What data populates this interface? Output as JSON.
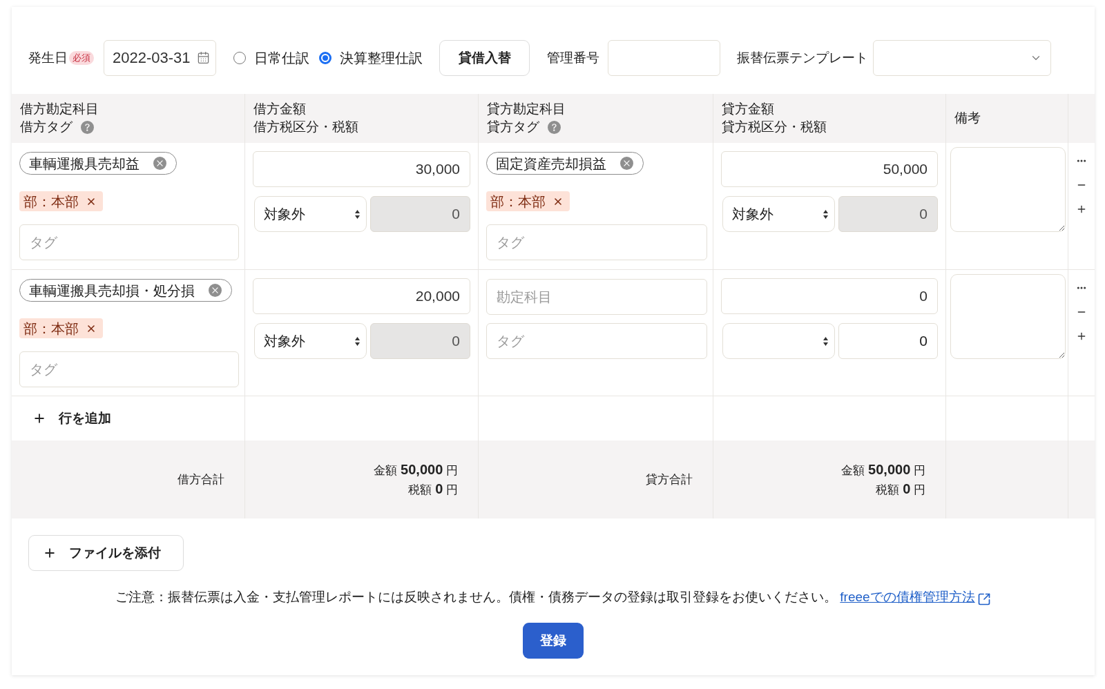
{
  "header": {
    "date_label": "発生日",
    "required_badge": "必須",
    "date_value": "2022-03-31",
    "entry_types": [
      {
        "label": "日常仕訳",
        "selected": false
      },
      {
        "label": "決算整理仕訳",
        "selected": true
      }
    ],
    "swap_button": "貸借入替",
    "control_number_label": "管理番号",
    "template_label": "振替伝票テンプレート"
  },
  "table": {
    "columns": [
      {
        "lines": [
          "借方勘定科目",
          "借方タグ"
        ],
        "help": true
      },
      {
        "lines": [
          "借方金額",
          "借方税区分・税額"
        ]
      },
      {
        "lines": [
          "貸方勘定科目",
          "貸方タグ"
        ],
        "help": true
      },
      {
        "lines": [
          "貸方金額",
          "貸方税区分・税額"
        ]
      },
      {
        "lines": [
          "備考"
        ]
      }
    ],
    "rows": [
      {
        "debit": {
          "account": "車輌運搬具売却益",
          "tags": [
            "部：本部"
          ],
          "tag_placeholder": "タグ",
          "amount": "30,000",
          "tax_category": "対象外",
          "tax": "0",
          "tax_disabled": true
        },
        "credit": {
          "account": "固定資産売却損益",
          "tags": [
            "部：本部"
          ],
          "tag_placeholder": "タグ",
          "amount": "50,000",
          "tax_category": "対象外",
          "tax": "0",
          "tax_disabled": true
        }
      },
      {
        "debit": {
          "account": "車輌運搬具売却損・処分損",
          "tags": [
            "部：本部"
          ],
          "tag_placeholder": "タグ",
          "amount": "20,000",
          "tax_category": "対象外",
          "tax": "0",
          "tax_disabled": true
        },
        "credit": {
          "account_placeholder": "勘定科目",
          "tag_placeholder": "タグ",
          "amount": "0",
          "tax": "0",
          "tax_disabled": false
        }
      }
    ],
    "add_row": "行を追加",
    "totals": [
      {
        "label": "借方合計",
        "lines": [
          "金額 **50,000** 円",
          "税額 **0** 円"
        ]
      },
      {
        "label": "貸方合計",
        "lines": [
          "金額 **50,000** 円",
          "税額 **0** 円"
        ]
      }
    ]
  },
  "footer": {
    "attach_button": "ファイルを添付",
    "notice": "ご注意：振替伝票は入金・支払管理レポートには反映されません。債権・債務データの登録は取引登録をお使いください。",
    "link": "freeeでの債権管理方法",
    "submit_button": "登録"
  }
}
